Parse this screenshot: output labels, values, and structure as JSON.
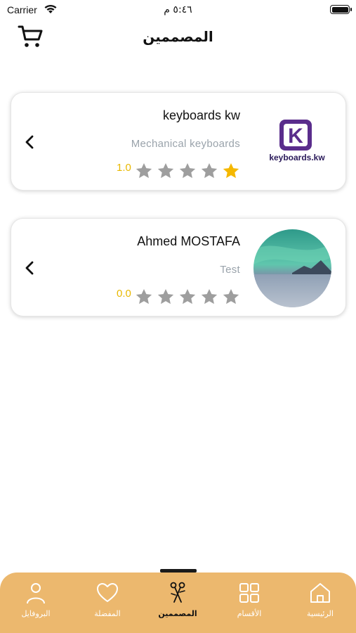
{
  "status_bar": {
    "carrier": "Carrier",
    "time": "٥:٤٦ م"
  },
  "header": {
    "title": "المصممين",
    "cart_icon": "cart-icon"
  },
  "designers": [
    {
      "name": "keyboards kw",
      "description": "Mechanical keyboards",
      "rating": "1.0",
      "stars_filled": 1,
      "stars_total": 5,
      "logo_text": "keyboards.kw",
      "logo_letter": "K"
    },
    {
      "name": "Ahmed MOSTAFA",
      "description": "Test",
      "rating": "0.0",
      "stars_filled": 0,
      "stars_total": 5
    }
  ],
  "tabs": [
    {
      "label": "البروفايل",
      "icon": "person-icon",
      "active": false
    },
    {
      "label": "المفضلة",
      "icon": "heart-icon",
      "active": false
    },
    {
      "label": "المصممين",
      "icon": "scissors-icon",
      "active": true
    },
    {
      "label": "الأقسام",
      "icon": "grid-icon",
      "active": false
    },
    {
      "label": "الرئيسية",
      "icon": "home-icon",
      "active": false
    }
  ],
  "colors": {
    "tab_bar": "#ecb86e",
    "star_filled": "#f5b800",
    "star_empty": "#9e9e9e",
    "rating_text": "#e8b800",
    "logo_purple": "#5a2d8c"
  }
}
